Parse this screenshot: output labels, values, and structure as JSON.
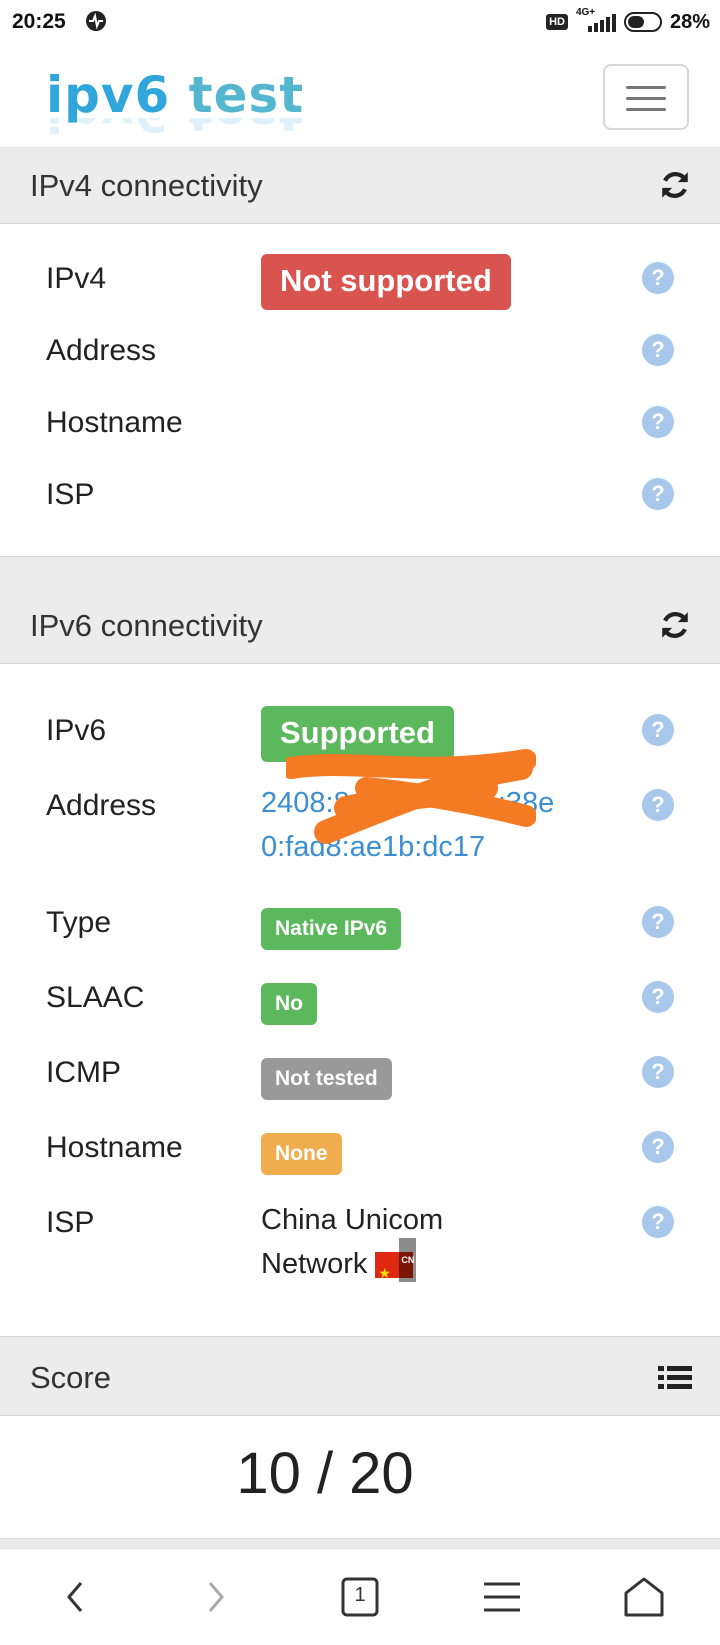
{
  "status_bar": {
    "time": "20:25",
    "hd": "HD",
    "network": "4G+",
    "battery": "28%"
  },
  "header": {
    "logo_part1": "ipv6",
    "logo_part2": "test",
    "menu_icon": "hamburger-icon"
  },
  "ipv4": {
    "title": "IPv4 connectivity",
    "rows": [
      {
        "label": "IPv4",
        "badge": "Not supported",
        "badge_color": "#d9534f"
      },
      {
        "label": "Address"
      },
      {
        "label": "Hostname"
      },
      {
        "label": "ISP"
      }
    ]
  },
  "ipv6": {
    "title": "IPv6 connectivity",
    "ipv6_label": "IPv6",
    "ipv6_badge": "Supported",
    "address_label": "Address",
    "address_line1": "2408:84",
    "address_line1_end": ":38e",
    "address_line2": "0:fad8:ae1b:dc17",
    "type_label": "Type",
    "type_badge": "Native IPv6",
    "slaac_label": "SLAAC",
    "slaac_badge": "No",
    "icmp_label": "ICMP",
    "icmp_badge": "Not tested",
    "hostname_label": "Hostname",
    "hostname_badge": "None",
    "isp_label": "ISP",
    "isp_line1": "China Unicom",
    "isp_line2": "Network",
    "isp_flag": "CN"
  },
  "score": {
    "title": "Score",
    "value": "10 / 20"
  },
  "help_icon": "?",
  "bottom_nav": {
    "tab_count": "1"
  },
  "colors": {
    "green": "#5cb85c",
    "red": "#d9534f",
    "gray": "#999999",
    "orange": "#f0ad4e",
    "help": "#a7c8ea",
    "link": "#3b8fd0"
  }
}
